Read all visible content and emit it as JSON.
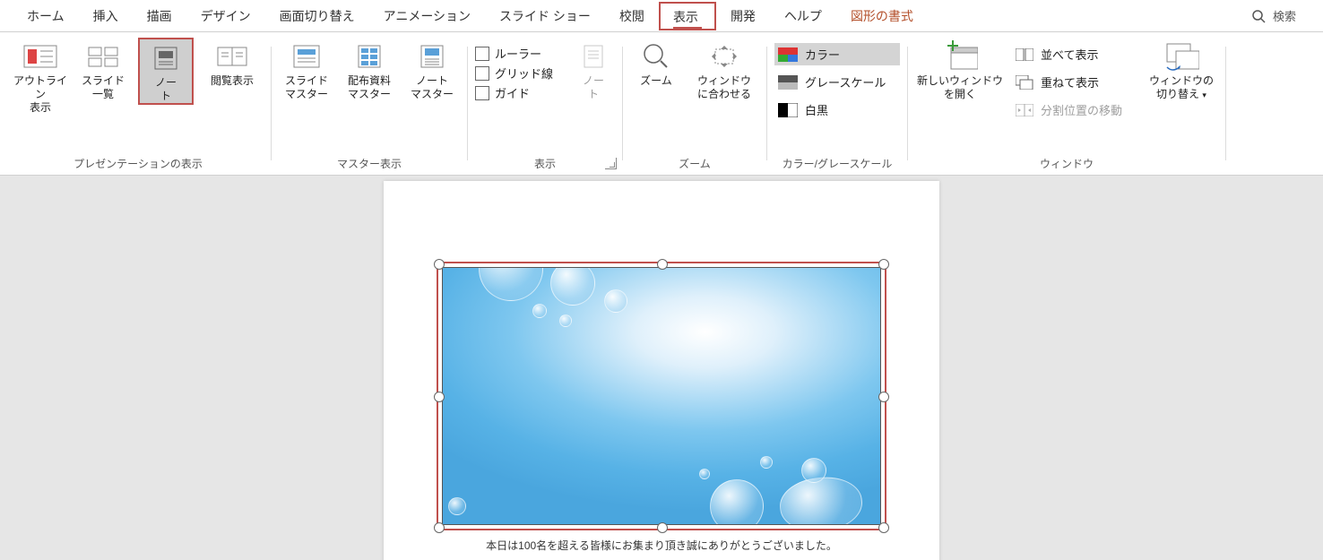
{
  "tabs": {
    "home": "ホーム",
    "insert": "挿入",
    "draw": "描画",
    "design": "デザイン",
    "transition": "画面切り替え",
    "animation": "アニメーション",
    "slideshow": "スライド ショー",
    "review": "校閲",
    "view": "表示",
    "developer": "開発",
    "help": "ヘルプ",
    "shape_format": "図形の書式"
  },
  "search_label": "検索",
  "ribbon": {
    "g1": {
      "label": "プレゼンテーションの表示",
      "outline": "アウトライン\n表示",
      "sorter": "スライド\n一覧",
      "notes": "ノー\nト",
      "reading": "閲覧表示"
    },
    "g2": {
      "label": "マスター表示",
      "slide": "スライド\nマスター",
      "handout": "配布資料\nマスター",
      "note": "ノート\nマスター"
    },
    "g3": {
      "label": "表示",
      "ruler": "ルーラー",
      "grid": "グリッド線",
      "guide": "ガイド",
      "notes_btn": "ノー\nト"
    },
    "g4": {
      "label": "ズーム",
      "zoom": "ズーム",
      "fit": "ウィンドウ\nに合わせる"
    },
    "g5": {
      "label": "カラー/グレースケール",
      "color": "カラー",
      "gray": "グレースケール",
      "bw": "白黒"
    },
    "g6": {
      "label": "ウィンドウ",
      "neww": "新しいウィンドウ\nを開く",
      "arrange": "並べて表示",
      "cascade": "重ねて表示",
      "split": "分割位置の移動",
      "switch": "ウィンドウの\n切り替え"
    }
  },
  "notes_caption": "本日は100名を超える皆様にお集まり頂き誠にありがとうございました。"
}
